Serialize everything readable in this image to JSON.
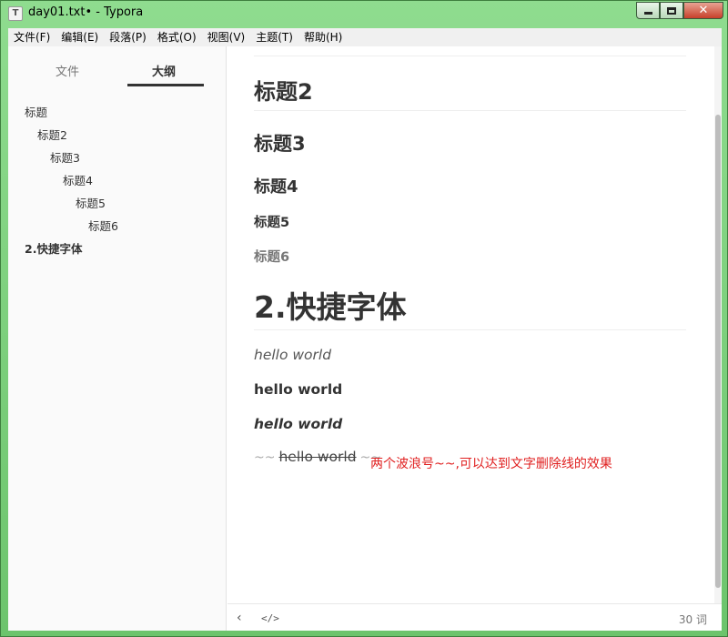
{
  "window": {
    "title": "day01.txt• - Typora",
    "app_icon_letter": "T",
    "close_glyph": "✕"
  },
  "menu": {
    "items": [
      "文件(F)",
      "编辑(E)",
      "段落(P)",
      "格式(O)",
      "视图(V)",
      "主题(T)",
      "帮助(H)"
    ]
  },
  "sidebar": {
    "tabs": {
      "files": "文件",
      "outline": "大纲"
    },
    "active_tab": "outline",
    "outline": [
      {
        "label": "标题",
        "level": 1
      },
      {
        "label": "标题2",
        "level": 2
      },
      {
        "label": "标题3",
        "level": 3
      },
      {
        "label": "标题4",
        "level": 4
      },
      {
        "label": "标题5",
        "level": 5
      },
      {
        "label": "标题6",
        "level": 6
      },
      {
        "label": "2.快捷字体",
        "level": 1,
        "bold": true
      }
    ]
  },
  "editor": {
    "h2": "标题2",
    "h3": "标题3",
    "h4": "标题4",
    "h5": "标题5",
    "h6": "标题6",
    "h1": "2.快捷字体",
    "italic": "hello world",
    "bold": "hello world",
    "bold_italic": "hello world",
    "strike_prefix": "~~",
    "strike_text": "hello world",
    "strike_suffix": "~~",
    "note": "两个波浪号~~,可以达到文字删除线的效果"
  },
  "statusbar": {
    "back_icon": "‹",
    "code_icon": "</>",
    "word_count": "30 词"
  },
  "colors": {
    "frame": "#7fd07f",
    "note_red": "#e02020",
    "heading": "#333333"
  }
}
